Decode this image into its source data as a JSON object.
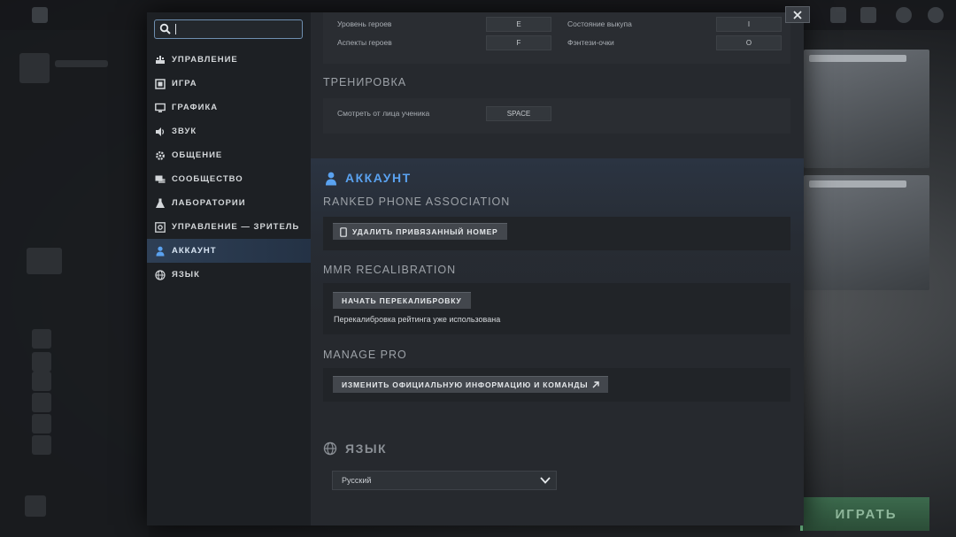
{
  "sidebar": {
    "search": {
      "value": "",
      "placeholder": ""
    },
    "items": [
      {
        "label": "УПРАВЛЕНИЕ",
        "icon": "gamepad-icon"
      },
      {
        "label": "ИГРА",
        "icon": "game-window-icon"
      },
      {
        "label": "ГРАФИКА",
        "icon": "monitor-icon"
      },
      {
        "label": "ЗВУК",
        "icon": "speaker-icon"
      },
      {
        "label": "ОБЩЕНИЕ",
        "icon": "gear-icon"
      },
      {
        "label": "СООБЩЕСТВО",
        "icon": "chat-icon"
      },
      {
        "label": "ЛАБОРАТОРИИ",
        "icon": "flask-icon"
      },
      {
        "label": "УПРАВЛЕНИЕ — ЗРИТЕЛЬ",
        "icon": "spectator-icon"
      },
      {
        "label": "АККАУНТ",
        "icon": "user-icon",
        "active": true
      },
      {
        "label": "ЯЗЫК",
        "icon": "globe-icon"
      }
    ]
  },
  "keybinds": {
    "rows": [
      {
        "label": "Уровень героев",
        "key": "E",
        "label2": "Состояние выкупа",
        "key2": "I"
      },
      {
        "label": "Аспекты героев",
        "key": "F",
        "label2": "Фэнтези-очки",
        "key2": "O"
      }
    ]
  },
  "training": {
    "title": "ТРЕНИРОВКА",
    "row": {
      "label": "Смотреть от лица ученика",
      "key": "SPACE"
    }
  },
  "account": {
    "title": "АККАУНТ",
    "ranked_phone": {
      "title": "RANKED PHONE ASSOCIATION",
      "button": "УДАЛИТЬ ПРИВЯЗАННЫЙ НОМЕР"
    },
    "mmr": {
      "title": "MMR RECALIBRATION",
      "button": "НАЧАТЬ ПЕРЕКАЛИБРОВКУ",
      "note": "Перекалибровка рейтинга уже использована"
    },
    "manage_pro": {
      "title": "MANAGE PRO",
      "button": "ИЗМЕНИТЬ ОФИЦИАЛЬНУЮ ИНФОРМАЦИЮ И КОМАНДЫ"
    }
  },
  "language": {
    "title": "ЯЗЫК",
    "selected": "Русский"
  },
  "background": {
    "play_button": "ИГРАТЬ"
  },
  "colors": {
    "accent": "#5aa2f0",
    "active_nav": "#2e3f55",
    "play": "#3c6a4d"
  }
}
